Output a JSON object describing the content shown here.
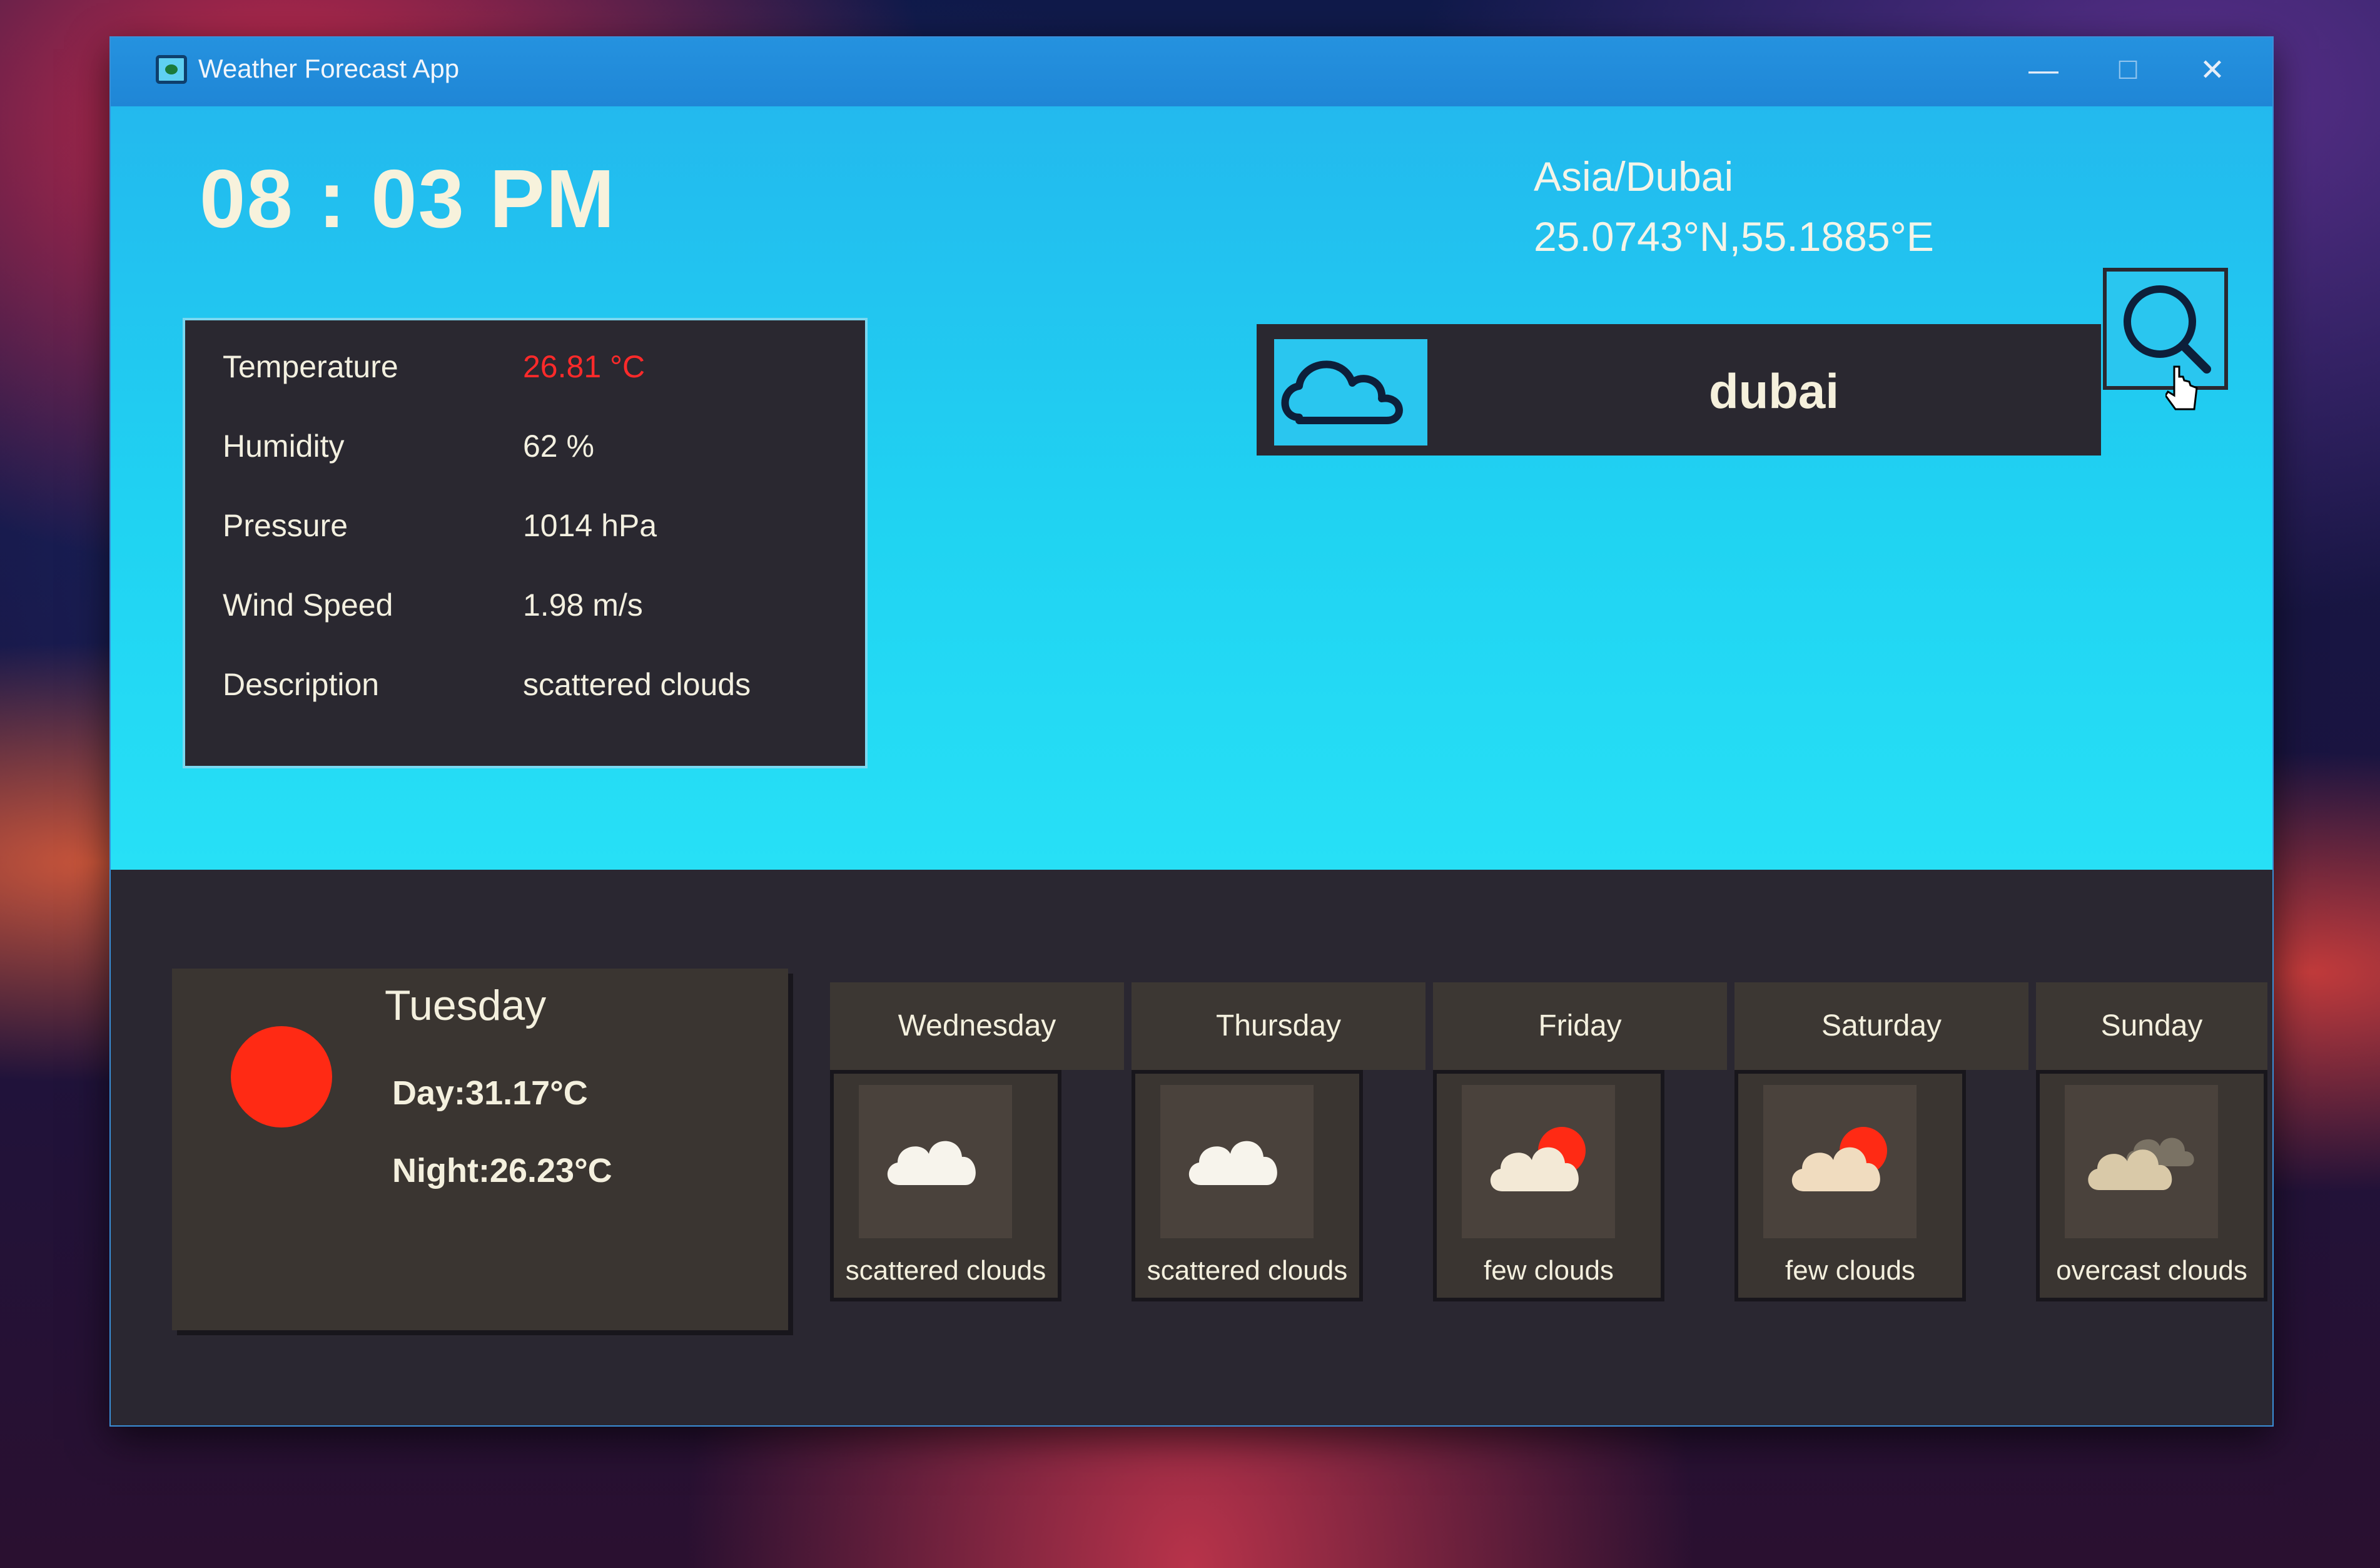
{
  "window": {
    "title": "Weather Forecast App",
    "controls": {
      "minimize": "—",
      "maximize": "☐",
      "close": "✕"
    }
  },
  "header": {
    "time": "08 : 03 PM",
    "timezone": "Asia/Dubai",
    "coordinates": "25.0743°N,55.1885°E"
  },
  "current": {
    "rows": [
      {
        "label": "Temperature",
        "value": "26.81 °C"
      },
      {
        "label": "Humidity",
        "value": "62 %"
      },
      {
        "label": "Pressure",
        "value": "1014 hPa"
      },
      {
        "label": "Wind Speed",
        "value": "1.98 m/s"
      },
      {
        "label": "Description",
        "value": "scattered clouds"
      }
    ],
    "temperature_color": "#ff2a2a"
  },
  "search": {
    "value": "dubai",
    "icon": "cloud-icon",
    "button_icon": "search-icon"
  },
  "today": {
    "day": "Tuesday",
    "day_temp": "Day:31.17°C",
    "night_temp": "Night:26.23°C",
    "icon": "sun-icon",
    "icon_color": "#ff2a14"
  },
  "forecast": [
    {
      "day": "Wednesday",
      "description": "scattered clouds",
      "icon": "cloud-icon"
    },
    {
      "day": "Thursday",
      "description": "scattered clouds",
      "icon": "cloud-icon"
    },
    {
      "day": "Friday",
      "description": "few clouds",
      "icon": "cloud-sun-icon"
    },
    {
      "day": "Saturday",
      "description": "few clouds",
      "icon": "cloud-sun-icon"
    },
    {
      "day": "Sunday",
      "description": "overcast clouds",
      "icon": "overcast-cloud-icon"
    }
  ],
  "colors": {
    "accent": "#23c8f0",
    "panel": "#2a2830"
  }
}
